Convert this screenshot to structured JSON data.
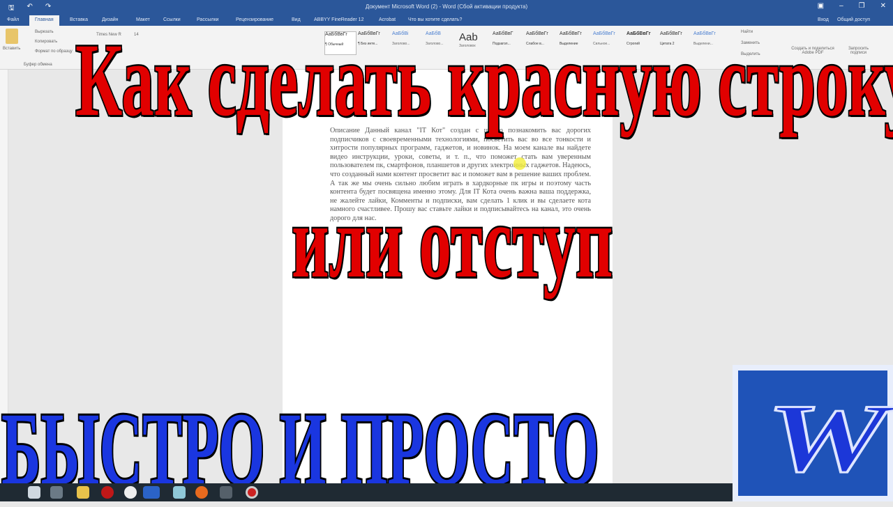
{
  "window": {
    "title": "Документ Microsoft Word (2) - Word (Сбой активации продукта)"
  },
  "tabs": [
    "Файл",
    "Главная",
    "Вставка",
    "Дизайн",
    "Макет",
    "Ссылки",
    "Рассылки",
    "Рецензирование",
    "Вид",
    "ABBYY FineReader 12",
    "Acrobat"
  ],
  "tell_me": "Что вы хотите сделать?",
  "signin": "Вход",
  "share": "Общий доступ",
  "clipboard": {
    "paste": "Вставить",
    "cut": "Вырезать",
    "copy": "Копировать",
    "format": "Формат по образцу",
    "group": "Буфер обмена"
  },
  "font": {
    "name": "Times New R",
    "size": "14"
  },
  "styles": [
    {
      "preview": "АаБбВвГг",
      "name": "¶ Обычный"
    },
    {
      "preview": "АаБбВвГг",
      "name": "¶ Без инте..."
    },
    {
      "preview": "АаБбВі",
      "name": "Заголово..."
    },
    {
      "preview": "АаБбВ",
      "name": "Заголово..."
    },
    {
      "preview": "Aab",
      "name": "Заголовок"
    },
    {
      "preview": "АаБбВвГ",
      "name": "Подзагол..."
    },
    {
      "preview": "АаБбВвГг",
      "name": "Слабое в..."
    },
    {
      "preview": "АаБбВвГг",
      "name": "Выделение"
    },
    {
      "preview": "АаБбВвГг",
      "name": "Сильное..."
    },
    {
      "preview": "АаБбВвГг",
      "name": "Строгий"
    },
    {
      "preview": "АаБбВвГг",
      "name": "Цитата 2"
    },
    {
      "preview": "АаБбВвГг",
      "name": "Выделени..."
    }
  ],
  "editing": {
    "find": "Найти",
    "replace": "Заменить",
    "select": "Выделить"
  },
  "adobe": {
    "create": "Создать и поделиться Adobe PDF",
    "request": "Запросить подписи"
  },
  "document_text": "Описание Данный канал \"IT Кот\" создан с целью познакомить вас дорогих подписчиков с своевременными технологиями, посветить вас во все тонкости и хитрости популярных программ, гаджетов, и новинок. На моем канале вы найдете видео инструкции, уроки, советы, и т. п., что поможет стать вам уверенным пользователем пк, смартфонов, планшетов и других электронных гаджетов. Надеюсь, что созданный нами контент просветит вас и поможет вам в решение ваших проблем. А так же мы очень сильно любим играть в хардкорные пк игры и поэтому часть контента будет посвящена именно этому. Для IT Кота очень важна ваша поддержка, не жалейте лайки, Комменты и подписки, вам сделать 1 клик и вы сделаете кота намного счастливее. Прошу вас ставьте лайки и подписывайтесь на канал, это очень дорого для нас.",
  "overlay": {
    "line1": "Как сделать красную строку",
    "line2": "или отступ",
    "line3": "БЫСТРО И ПРОСТО"
  },
  "logo_letter": "W"
}
